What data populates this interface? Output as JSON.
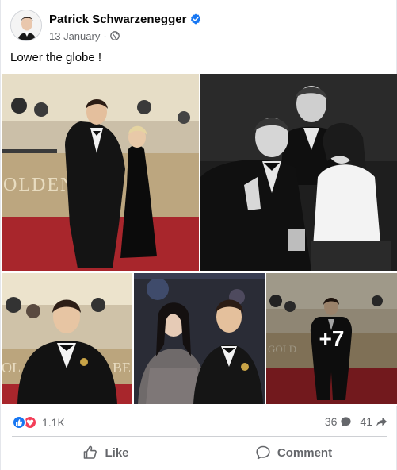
{
  "post": {
    "author": "Patrick Schwarzenegger",
    "date": "13 January",
    "separator": "·",
    "caption": "Lower the globe !",
    "more_photos_label": "+7"
  },
  "icons": {
    "verified": "verified-badge-icon",
    "privacy": "globe-icon",
    "like_reaction": "thumbs-up-icon",
    "love_reaction": "heart-icon",
    "comments": "comment-bubble-icon",
    "shares": "share-arrow-icon",
    "like_action": "thumbs-up-outline-icon",
    "comment_action": "comment-outline-icon"
  },
  "stats": {
    "reactions": "1.1K",
    "comments": "36",
    "shares": "41"
  },
  "actions": {
    "like": "Like",
    "comment": "Comment"
  },
  "colors": {
    "accent_blue": "#1877f2",
    "love_red": "#f33e58",
    "muted_text": "#65676b",
    "red_carpet": "#a8262c"
  }
}
